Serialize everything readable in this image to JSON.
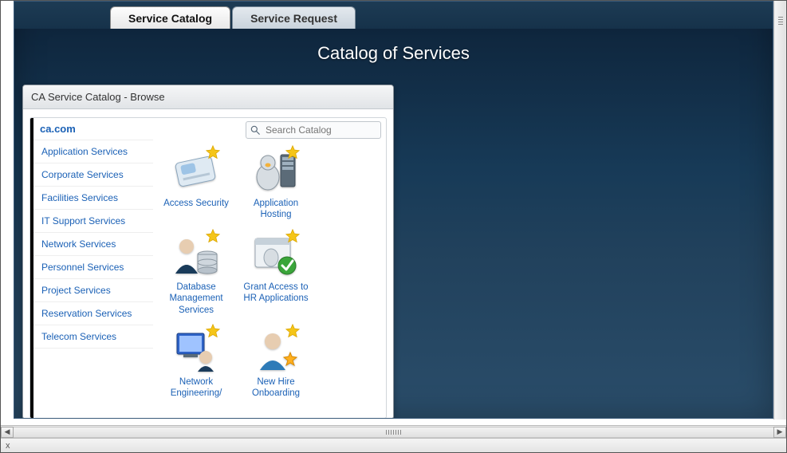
{
  "tabs": {
    "active": "Service Catalog",
    "inactive": "Service Request"
  },
  "hero_title": "Catalog of Services",
  "panel_title": "CA Service Catalog - Browse",
  "tenant": "ca.com",
  "search": {
    "placeholder": "Search Catalog"
  },
  "sidebar": {
    "items": [
      "Application Services",
      "Corporate Services",
      "Facilities Services",
      "IT Support Services",
      "Network Services",
      "Personnel Services",
      "Project Services",
      "Reservation Services",
      "Telecom Services"
    ]
  },
  "tiles": {
    "r1": [
      {
        "label": "Access Security",
        "icon": "id-card-icon"
      },
      {
        "label": "Application Hosting",
        "icon": "server-penguin-icon"
      }
    ],
    "r2": [
      {
        "label": "Database Management Services",
        "icon": "dba-icon"
      },
      {
        "label": "Grant Access to HR Applications",
        "icon": "window-check-icon"
      }
    ],
    "r3": [
      {
        "label": "Network Engineering/",
        "icon": "netops-icon"
      },
      {
        "label": "New Hire Onboarding",
        "icon": "newhire-icon"
      }
    ]
  },
  "status": {
    "text": "x"
  },
  "colors": {
    "link": "#1b61b6",
    "star": "#f5c518",
    "check": "#3aa53a",
    "gold": "#d9a400"
  }
}
